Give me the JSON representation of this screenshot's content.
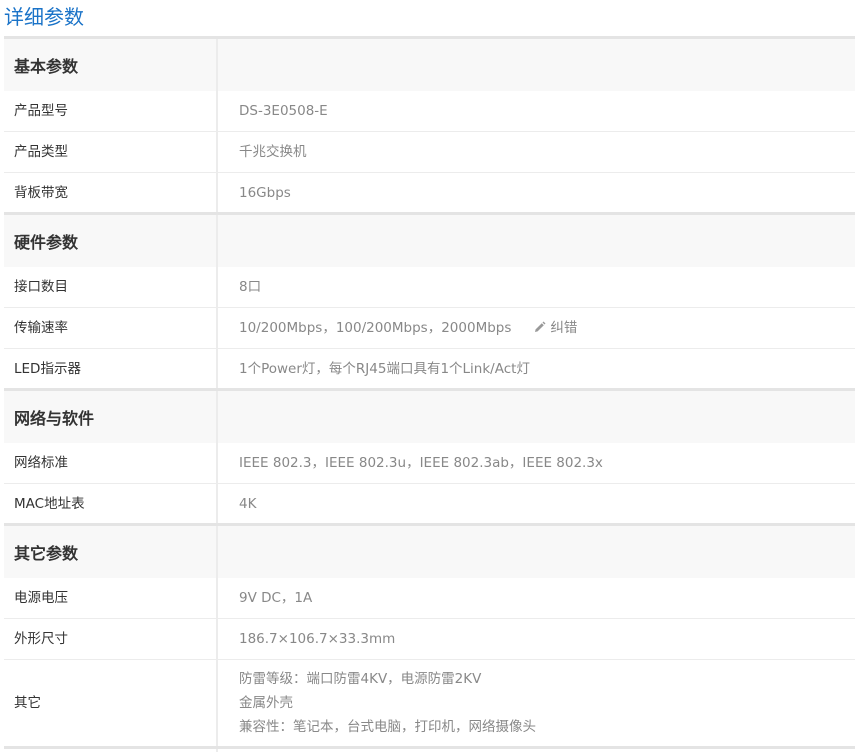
{
  "page_title": "详细参数",
  "sections": [
    {
      "title": "基本参数",
      "rows": [
        {
          "key": "产品型号",
          "value": "DS-3E0508-E"
        },
        {
          "key": "产品类型",
          "value": "千兆交换机"
        },
        {
          "key": "背板带宽",
          "value": "16Gbps"
        }
      ]
    },
    {
      "title": "硬件参数",
      "rows": [
        {
          "key": "接口数目",
          "value": "8口"
        },
        {
          "key": "传输速率",
          "value": "10/200Mbps，100/200Mbps，2000Mbps"
        },
        {
          "key": "LED指示器",
          "value": "1个Power灯，每个RJ45端口具有1个Link/Act灯"
        }
      ]
    },
    {
      "title": "网络与软件",
      "rows": [
        {
          "key": "网络标准",
          "value": "IEEE 802.3，IEEE 802.3u，IEEE 802.3ab，IEEE 802.3x"
        },
        {
          "key": "MAC地址表",
          "value": "4K"
        }
      ]
    },
    {
      "title": "其它参数",
      "rows": [
        {
          "key": "电源电压",
          "value": "9V DC，1A"
        },
        {
          "key": "外形尺寸",
          "value": "186.7×106.7×33.3mm"
        },
        {
          "key": "其它",
          "value_lines": [
            "防雷等级：端口防雷4KV，电源防雷2KV",
            "金属外壳",
            "兼容性：笔记本，台式电脑，打印机，网络摄像头"
          ]
        }
      ]
    }
  ],
  "correction_link": {
    "label": "纠错",
    "icon": "pencil-icon"
  },
  "colors": {
    "title": "#1a73c8",
    "section_bg": "#f8f8f8",
    "value_text": "#888888",
    "key_text": "#333333"
  }
}
